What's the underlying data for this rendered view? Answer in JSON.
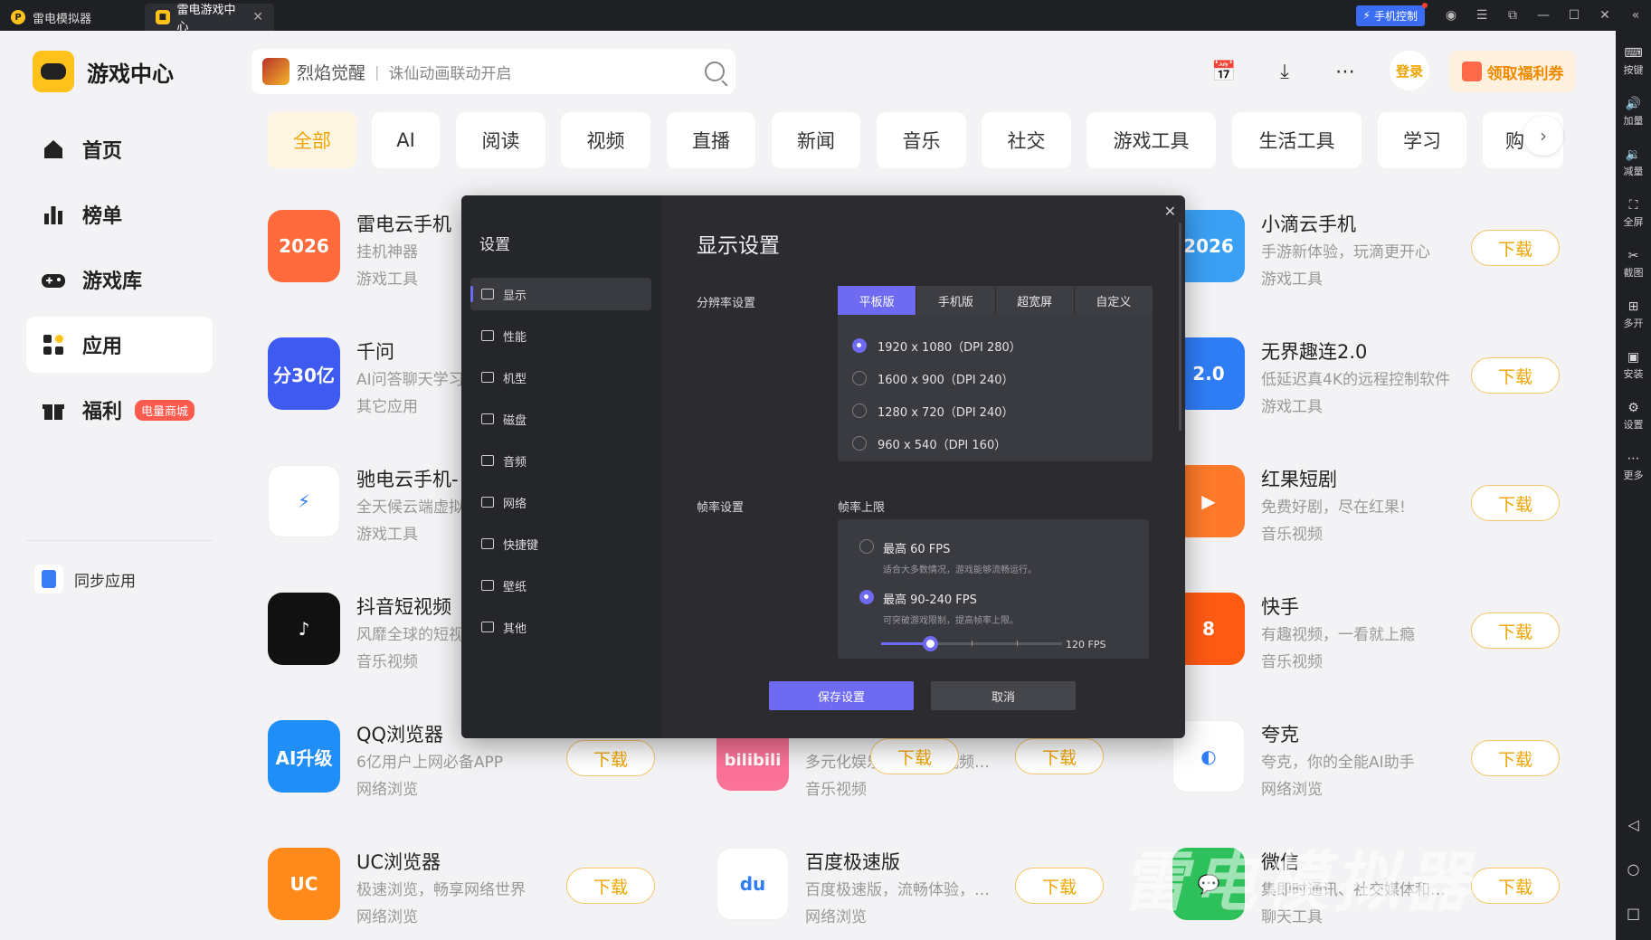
{
  "titlebar": {
    "tabs": [
      {
        "label": "雷电模拟器"
      },
      {
        "label": "雷电游戏中心"
      }
    ],
    "phone_control": "手机控制"
  },
  "right_toolbar": [
    {
      "label": "按键",
      "icon": "keyboard-icon"
    },
    {
      "label": "加量",
      "icon": "volume-up-icon"
    },
    {
      "label": "减量",
      "icon": "volume-down-icon"
    },
    {
      "label": "全屏",
      "icon": "fullscreen-icon"
    },
    {
      "label": "截图",
      "icon": "scissors-icon"
    },
    {
      "label": "多开",
      "icon": "multi-instance-icon"
    },
    {
      "label": "安装",
      "icon": "install-icon"
    },
    {
      "label": "设置",
      "icon": "gear-icon"
    },
    {
      "label": "更多",
      "icon": "more-icon"
    }
  ],
  "sidebar": {
    "title": "游戏中心",
    "items": [
      {
        "label": "首页",
        "icon": "home-icon"
      },
      {
        "label": "榜单",
        "icon": "ranking-icon"
      },
      {
        "label": "游戏库",
        "icon": "gamepad-icon"
      },
      {
        "label": "应用",
        "icon": "apps-icon"
      },
      {
        "label": "福利",
        "icon": "gift-icon",
        "badge": "电量商城"
      }
    ],
    "active_index": 3,
    "sync": "同步应用"
  },
  "header": {
    "search_hot": "烈焰觉醒",
    "search_sep": "|",
    "search_sub": "诛仙动画联动开启",
    "login": "登录",
    "welfare": "领取福利券"
  },
  "categories": [
    "全部",
    "AI",
    "阅读",
    "视频",
    "直播",
    "新闻",
    "音乐",
    "社交",
    "游戏工具",
    "生活工具",
    "学习",
    "购"
  ],
  "download_label": "下载",
  "apps": [
    {
      "name": "雷电云手机",
      "desc": "挂机神器",
      "category": "游戏工具",
      "color": "#ff6a3d",
      "glyph": "2026"
    },
    {
      "name": "小滴云手机",
      "desc": "手游新体验，玩滴更开心",
      "category": "游戏工具",
      "color": "#3aa0f4",
      "glyph": "2026"
    },
    {
      "name": "千问",
      "desc": "AI问答聊天学习",
      "category": "其它应用",
      "color": "#3e5af0",
      "glyph": "分30亿"
    },
    {
      "name": "无界趣连2.0",
      "desc": "低延迟真4K的远程控制软件",
      "category": "游戏工具",
      "color": "#2f7df6",
      "glyph": "2.0"
    },
    {
      "name": "驰电云手机-",
      "desc": "全天候云端虚拟",
      "category": "游戏工具",
      "color": "#ffffff",
      "glyph": "⚡"
    },
    {
      "name": "红果短剧",
      "desc": "免费好剧，尽在红果!",
      "category": "音乐视频",
      "color": "#ff7a2a",
      "glyph": "▶"
    },
    {
      "name": "抖音短视频",
      "desc": "风靡全球的短视",
      "category": "音乐视频",
      "color": "#111111",
      "glyph": "♪"
    },
    {
      "name": "快手",
      "desc": "有趣视频，一看就上瘾",
      "category": "音乐视频",
      "color": "#ff5a12",
      "glyph": "8"
    },
    {
      "name": "QQ浏览器",
      "desc": "6亿用户上网必备APP",
      "category": "网络浏览",
      "color": "#1f8ef6",
      "glyph": "AI升级"
    },
    {
      "name": "夸克",
      "desc": "夸克，你的全能AI助手",
      "category": "网络浏览",
      "color": "#ffffff",
      "glyph": "◐"
    },
    {
      "name": "UC浏览器",
      "desc": "极速浏览，畅享网络世界",
      "category": "网络浏览",
      "color": "#ff8a1a",
      "glyph": "UC"
    },
    {
      "name": "百度极速版",
      "desc": "百度极速版，流畅体验，…",
      "category": "网络浏览",
      "color": "#ffffff",
      "glyph": "du"
    },
    {
      "name": "微信",
      "desc": "集即时通讯、社交媒体和…",
      "category": "聊天工具",
      "color": "#2ec15b",
      "glyph": "💬"
    }
  ],
  "bilibili_partial": {
    "desc": "多元化娱乐的综合性视频…",
    "category": "音乐视频",
    "glyph": "bilibili"
  },
  "dialog": {
    "title": "设置",
    "menu": [
      "显示",
      "性能",
      "机型",
      "磁盘",
      "音频",
      "网络",
      "快捷键",
      "壁纸",
      "其他"
    ],
    "heading": "显示设置",
    "resolution_label": "分辨率设置",
    "tabs": [
      "平板版",
      "手机版",
      "超宽屏",
      "自定义"
    ],
    "resolutions": [
      "1920 x 1080（DPI 280）",
      "1600 x 900（DPI 240）",
      "1280 x 720（DPI 240）",
      "960 x 540（DPI 160）"
    ],
    "selected_resolution": 0,
    "fps_label": "帧率设置",
    "fps_limit_label": "帧率上限",
    "fps_options": [
      {
        "title": "最高 60 FPS",
        "desc": "适合大多数情况，游戏能够流畅运行。"
      },
      {
        "title": "最高 90-240 FPS",
        "desc": "可突破游戏限制，提高帧率上限。"
      }
    ],
    "selected_fps": 1,
    "fps_value": "120 FPS",
    "slider_fraction": 0.27,
    "save": "保存设置",
    "cancel": "取消"
  },
  "watermark": "雷电模拟器",
  "colors": {
    "accent": "#ffc21a",
    "dialog_accent": "#6e6af2",
    "download": "#f0a400"
  }
}
